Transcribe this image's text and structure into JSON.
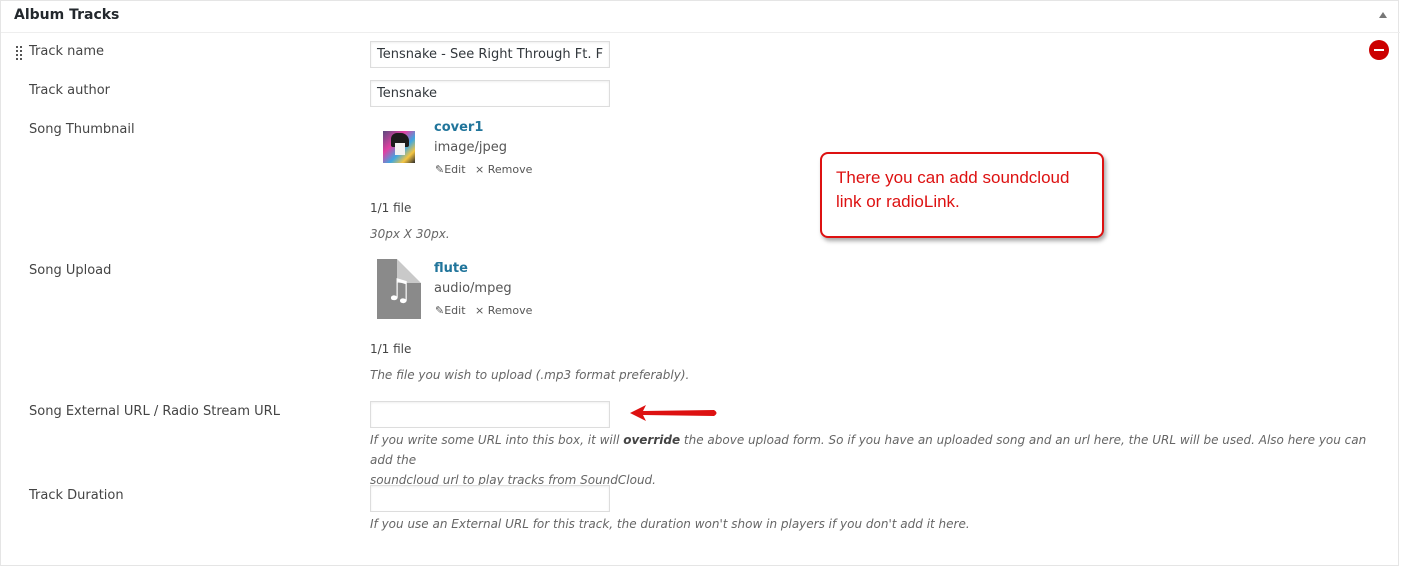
{
  "panel": {
    "title": "Album Tracks"
  },
  "fields": {
    "track_name": {
      "label": "Track name",
      "value": "Tensnake - See Right Through Ft. F"
    },
    "track_author": {
      "label": "Track author",
      "value": "Tensnake"
    },
    "song_thumbnail": {
      "label": "Song Thumbnail",
      "file_name": "cover1",
      "file_type": "image/jpeg",
      "edit_label": "Edit",
      "remove_label": "Remove",
      "count": "1/1 file",
      "description": "30px X 30px."
    },
    "song_upload": {
      "label": "Song Upload",
      "file_name": "flute",
      "file_type": "audio/mpeg",
      "edit_label": "Edit",
      "remove_label": "Remove",
      "count": "1/1 file",
      "description": "The file you wish to upload (.mp3 format preferably)."
    },
    "external_url": {
      "label": "Song External URL / Radio Stream URL",
      "value": "",
      "desc_before": "If you write some URL into this box, it will ",
      "desc_bold": "override",
      "desc_after_line1": " the above upload form. So if you have an uploaded song and an url here, the URL will be used. Also here you can add the",
      "desc_line2": "soundcloud url to play tracks from SoundCloud."
    },
    "track_duration": {
      "label": "Track Duration",
      "value": "",
      "description": "If you use an External URL for this track, the duration won't show in players if you don't add it here."
    }
  },
  "annotation": {
    "callout_text": "There you can add soundcloud link or radioLink."
  },
  "icons": {
    "collapse": "triangle-up-icon",
    "drag": "drag-handle-icon",
    "remove_row": "minus-circle-icon",
    "edit": "pencil-icon",
    "remove": "x-icon",
    "audio_file": "music-note-file-icon",
    "annotation_arrow": "red-arrow-left-icon"
  },
  "colors": {
    "link": "#21759b",
    "remove_red": "#cc0000",
    "annotation_red": "#dd1111"
  }
}
